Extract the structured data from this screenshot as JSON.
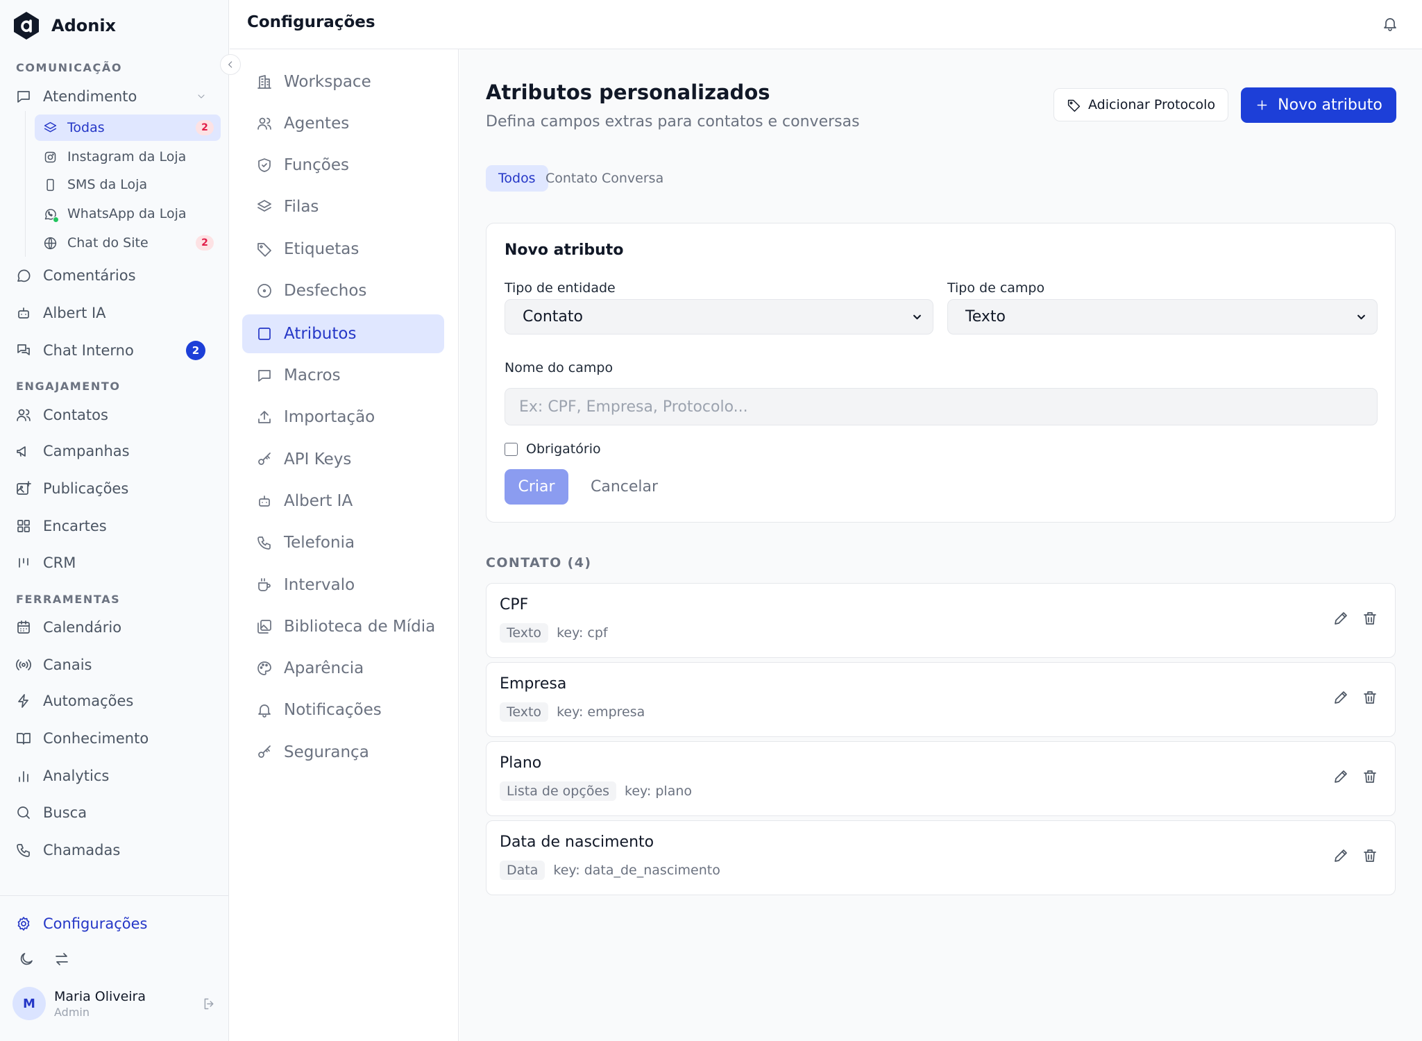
{
  "brand": {
    "name": "Adonix"
  },
  "sidebar": {
    "sections": [
      {
        "title": "COMUNICAÇÃO"
      },
      {
        "title": "ENGAJAMENTO"
      },
      {
        "title": "FERRAMENTAS"
      }
    ],
    "atendimento": {
      "label": "Atendimento",
      "subitems": [
        {
          "label": "Todas",
          "badge": "2",
          "icon": "layers-icon"
        },
        {
          "label": "Instagram da Loja",
          "icon": "instagram-icon"
        },
        {
          "label": "SMS da Loja",
          "icon": "phone-icon"
        },
        {
          "label": "WhatsApp da Loja",
          "icon": "whatsapp-icon"
        },
        {
          "label": "Chat do Site",
          "badge": "2",
          "icon": "globe-icon"
        }
      ]
    },
    "communication": [
      {
        "label": "Comentários",
        "icon": "message-circle-icon"
      },
      {
        "label": "Albert IA",
        "icon": "bot-icon"
      },
      {
        "label": "Chat Interno",
        "badge": "2",
        "icon": "messages-icon"
      }
    ],
    "engagement": [
      {
        "label": "Contatos",
        "icon": "users-icon"
      },
      {
        "label": "Campanhas",
        "icon": "megaphone-icon"
      },
      {
        "label": "Publicações",
        "icon": "image-plus-icon"
      },
      {
        "label": "Encartes",
        "icon": "grid-icon"
      },
      {
        "label": "CRM",
        "icon": "kanban-icon"
      }
    ],
    "tools": [
      {
        "label": "Calendário",
        "icon": "calendar-icon"
      },
      {
        "label": "Canais",
        "icon": "radio-icon"
      },
      {
        "label": "Automações",
        "icon": "zap-icon"
      },
      {
        "label": "Conhecimento",
        "icon": "book-icon"
      },
      {
        "label": "Analytics",
        "icon": "bar-chart-icon"
      },
      {
        "label": "Busca",
        "icon": "search-icon"
      },
      {
        "label": "Chamadas",
        "icon": "phone-call-icon"
      }
    ],
    "settings_label": "Configurações",
    "user": {
      "initial": "M",
      "name": "Maria Oliveira",
      "role": "Admin"
    }
  },
  "header": {
    "title": "Configurações"
  },
  "settings_nav": [
    {
      "label": "Workspace",
      "icon": "building-icon"
    },
    {
      "label": "Agentes",
      "icon": "users-icon"
    },
    {
      "label": "Funções",
      "icon": "shield-icon"
    },
    {
      "label": "Filas",
      "icon": "layers-icon"
    },
    {
      "label": "Etiquetas",
      "icon": "tag-icon"
    },
    {
      "label": "Desfechos",
      "icon": "circle-dot-icon"
    },
    {
      "label": "Atributos",
      "icon": "square-icon",
      "active": true
    },
    {
      "label": "Macros",
      "icon": "message-square-icon"
    },
    {
      "label": "Importação",
      "icon": "upload-icon"
    },
    {
      "label": "API Keys",
      "icon": "key-icon"
    },
    {
      "label": "Albert IA",
      "icon": "bot-icon"
    },
    {
      "label": "Telefonia",
      "icon": "phone-icon"
    },
    {
      "label": "Intervalo",
      "icon": "coffee-icon"
    },
    {
      "label": "Biblioteca de Mídia",
      "icon": "images-icon"
    },
    {
      "label": "Aparência",
      "icon": "palette-icon"
    },
    {
      "label": "Notificações",
      "icon": "bell-icon"
    },
    {
      "label": "Segurança",
      "icon": "key-icon"
    }
  ],
  "main": {
    "title": "Atributos personalizados",
    "subtitle": "Defina campos extras para contatos e conversas",
    "add_protocol_label": "Adicionar Protocolo",
    "new_attribute_label": "Novo atributo",
    "tabs": [
      {
        "label": "Todos",
        "active": true
      },
      {
        "label": "Contato"
      },
      {
        "label": "Conversa"
      }
    ],
    "form": {
      "title": "Novo atributo",
      "entity_label": "Tipo de entidade",
      "entity_value": "Contato",
      "field_type_label": "Tipo de campo",
      "field_type_value": "Texto",
      "name_label": "Nome do campo",
      "name_placeholder": "Ex: CPF, Empresa, Protocolo...",
      "name_value": "",
      "required_label": "Obrigatório",
      "required_checked": false,
      "create_label": "Criar",
      "cancel_label": "Cancelar"
    },
    "group_title": "CONTATO (4)",
    "attributes": [
      {
        "name": "CPF",
        "type": "Texto",
        "key": "key: cpf"
      },
      {
        "name": "Empresa",
        "type": "Texto",
        "key": "key: empresa"
      },
      {
        "name": "Plano",
        "type": "Lista de opções",
        "key": "key: plano"
      },
      {
        "name": "Data de nascimento",
        "type": "Data",
        "key": "key: data_de_nascimento"
      }
    ]
  },
  "colors": {
    "accent": "#1d3fd8",
    "accent_soft": "#e0e7ff",
    "badge_red": "#e11d48",
    "online_dot": "#22c55e"
  }
}
